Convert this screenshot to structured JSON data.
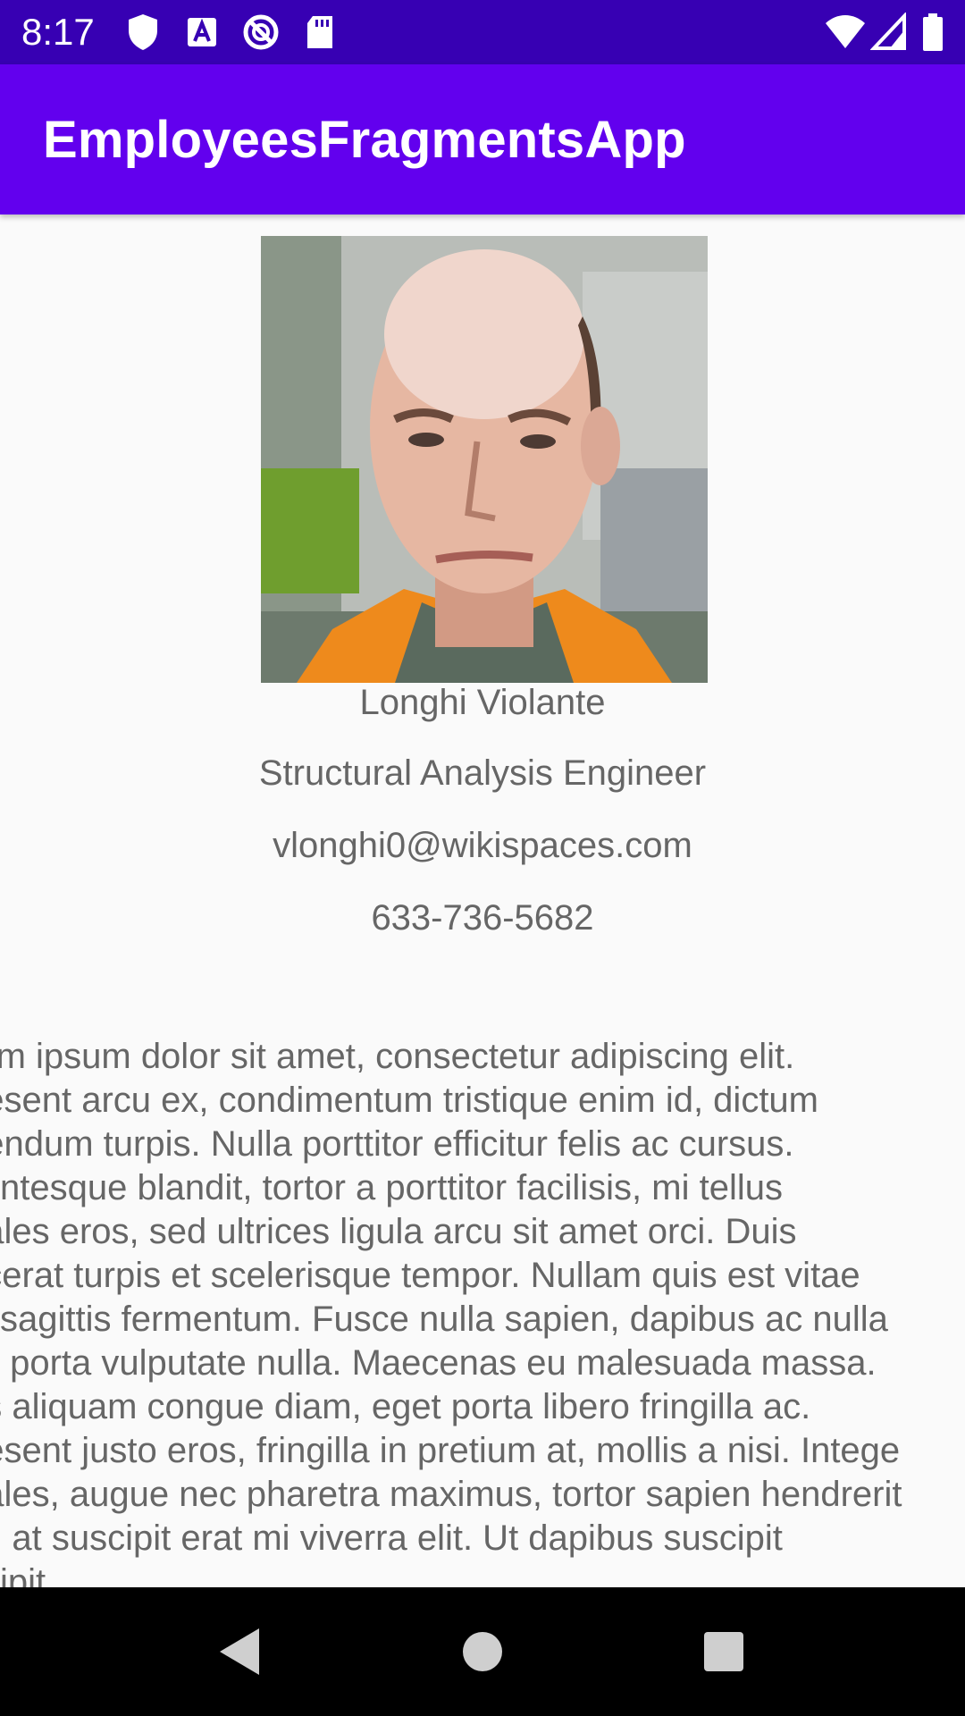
{
  "status_bar": {
    "time": "8:17"
  },
  "app_bar": {
    "title": "EmployeesFragmentsApp"
  },
  "employee": {
    "photo_description": "Employee headshot photo",
    "name": "Longhi Violante",
    "title": "Structural Analysis Engineer",
    "email": "vlonghi0@wikispaces.com",
    "phone": "633-736-5682",
    "bio_lines": [
      "rem ipsum dolor sit amet, consectetur adipiscing elit.",
      "aesent arcu ex, condimentum tristique enim id, dictum",
      "oendum turpis. Nulla porttitor efficitur felis ac cursus.",
      "llentesque blandit, tortor a porttitor facilisis, mi tellus",
      "dales eros, sed ultrices ligula arcu sit amet orci. Duis",
      "acerat turpis et scelerisque tempor. Nullam quis est vitae",
      "sl sagittis fermentum. Fusce nulla sapien, dapibus ac nulla",
      "is, porta vulputate nulla. Maecenas eu malesuada massa.",
      "as aliquam congue diam, eget porta libero fringilla ac.",
      "aesent justo eros, fringilla in pretium at, mollis a nisi. Intege",
      "dales, augue nec pharetra maximus, tortor sapien hendrerit",
      "io, at suscipit erat mi viverra elit. Ut dapibus suscipit",
      "scipit"
    ]
  },
  "icons": {
    "status_left": [
      "shield-icon",
      "font-icon",
      "sync-icon",
      "sd-card-icon"
    ],
    "status_right": [
      "wifi-icon",
      "signal-icon",
      "battery-icon"
    ],
    "nav": [
      "back-icon",
      "home-icon",
      "recents-icon"
    ]
  },
  "colors": {
    "status_bar": "#3700b3",
    "app_bar": "#6200ee",
    "background": "#fafafa",
    "text": "#666666",
    "nav_bar": "#000000"
  }
}
